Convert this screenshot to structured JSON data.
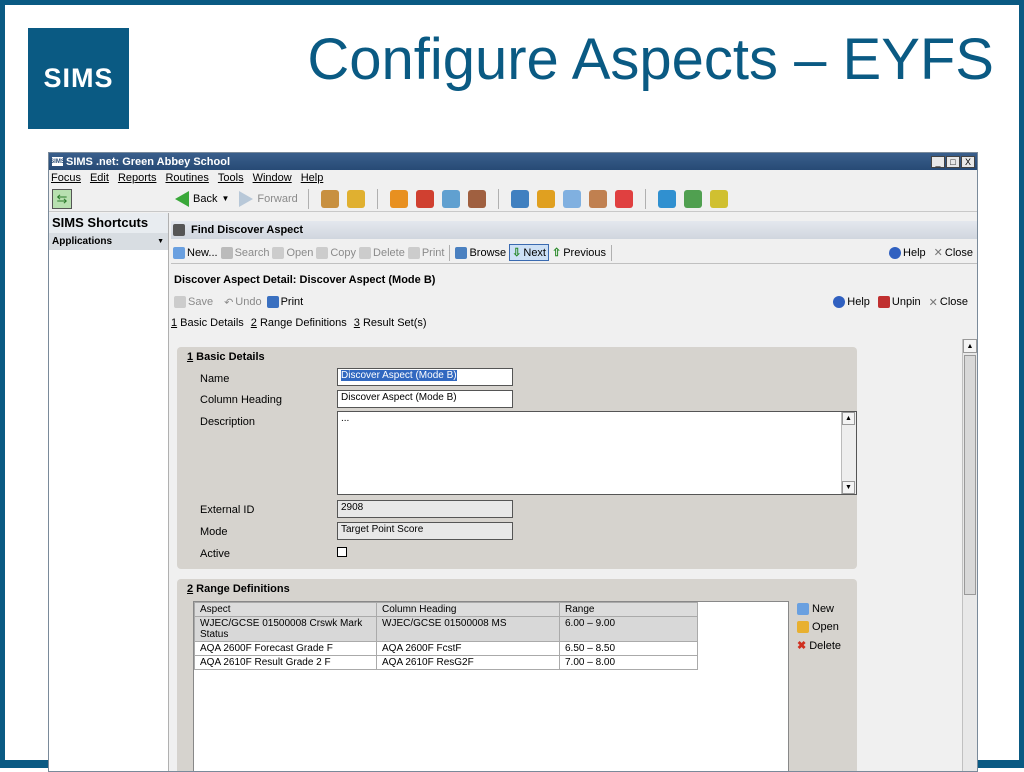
{
  "slide": {
    "logo": "SIMS",
    "title": "Configure Aspects – EYFS",
    "accent_color": "#0a5a83"
  },
  "window": {
    "app_icon": "SIMS",
    "title": "SIMS .net: Green Abbey School",
    "controls": [
      "_",
      "□",
      "X"
    ]
  },
  "menu": [
    "Focus",
    "Edit",
    "Reports",
    "Routines",
    "Tools",
    "Window",
    "Help"
  ],
  "nav": {
    "back": "Back",
    "forward": "Forward"
  },
  "sidebar": {
    "title": "SIMS Shortcuts",
    "applications": "Applications"
  },
  "find_bar": {
    "title": "Find Discover Aspect"
  },
  "toolbar2": {
    "new": "New...",
    "search": "Search",
    "open": "Open",
    "copy": "Copy",
    "delete": "Delete",
    "print": "Print",
    "browse": "Browse",
    "next": "Next",
    "previous": "Previous",
    "help": "Help",
    "close": "Close"
  },
  "detail": {
    "title": "Discover Aspect Detail: Discover Aspect (Mode B)",
    "save": "Save",
    "undo": "Undo",
    "print": "Print",
    "help": "Help",
    "unpin": "Unpin",
    "close": "Close",
    "links": [
      {
        "num": "1",
        "label": " Basic Details"
      },
      {
        "num": "2",
        "label": " Range Definitions"
      },
      {
        "num": "3",
        "label": " Result Set(s)"
      }
    ]
  },
  "basic_details": {
    "num": "1",
    "title": " Basic Details",
    "name_label": "Name",
    "name_value": "Discover Aspect (Mode B)",
    "column_heading_label": "Column Heading",
    "column_heading_value": "Discover Aspect (Mode B)",
    "description_label": "Description",
    "description_value": "...",
    "external_id_label": "External ID",
    "external_id_value": "2908",
    "mode_label": "Mode",
    "mode_value": "Target Point Score",
    "active_label": "Active"
  },
  "range_definitions": {
    "num": "2",
    "title": " Range Definitions",
    "columns": [
      "Aspect",
      "Column Heading",
      "Range"
    ],
    "rows": [
      {
        "aspect": "WJEC/GCSE 01500008 Crswk Mark Status",
        "heading": "WJEC/GCSE 01500008 MS",
        "range": "6.00 – 9.00"
      },
      {
        "aspect": "AQA 2600F Forecast Grade F",
        "heading": "AQA 2600F FcstF",
        "range": "6.50 – 8.50"
      },
      {
        "aspect": "AQA 2610F Result Grade 2 F",
        "heading": "AQA 2610F ResG2F",
        "range": "7.00 – 8.00"
      }
    ],
    "actions": {
      "new": "New",
      "open": "Open",
      "delete": "Delete"
    }
  }
}
